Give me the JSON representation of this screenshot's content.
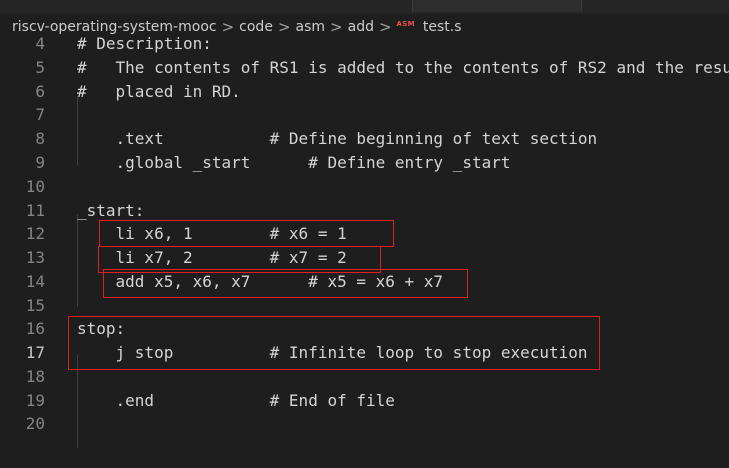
{
  "breadcrumb": {
    "items": [
      "riscv-operating-system-mooc",
      "code",
      "asm",
      "add"
    ],
    "file_icon": "ASM",
    "file_name": "test.s",
    "separator": ">"
  },
  "editor": {
    "language": "RISC-V assembly",
    "active_line": 17,
    "lines": [
      {
        "number": "4",
        "text": "# Description:"
      },
      {
        "number": "5",
        "text": "#   The contents of RS1 is added to the contents of RS2 and the resu"
      },
      {
        "number": "6",
        "text": "#   placed in RD."
      },
      {
        "number": "7",
        "text": ""
      },
      {
        "number": "8",
        "text": "    .text           # Define beginning of text section"
      },
      {
        "number": "9",
        "text": "    .global _start      # Define entry _start"
      },
      {
        "number": "10",
        "text": ""
      },
      {
        "number": "11",
        "text": "_start:"
      },
      {
        "number": "12",
        "text": "    li x6, 1        # x6 = 1"
      },
      {
        "number": "13",
        "text": "    li x7, 2        # x7 = 2"
      },
      {
        "number": "14",
        "text": "    add x5, x6, x7      # x5 = x6 + x7"
      },
      {
        "number": "15",
        "text": ""
      },
      {
        "number": "16",
        "text": "stop:"
      },
      {
        "number": "17",
        "text": "    j stop          # Infinite loop to stop execution"
      },
      {
        "number": "18",
        "text": ""
      },
      {
        "number": "19",
        "text": "    .end            # End of file"
      },
      {
        "number": "20",
        "text": ""
      }
    ]
  },
  "colors": {
    "background": "#1e1e1e",
    "text": "#d4d4d4",
    "line_number": "#858585",
    "annotation": "#e21f1f",
    "asm_icon": "#f14c4c"
  }
}
